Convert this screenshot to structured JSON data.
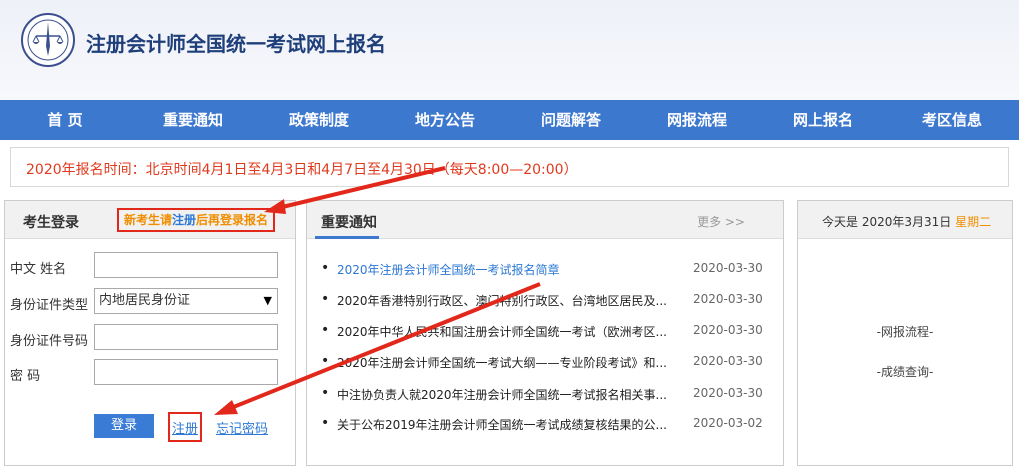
{
  "header": {
    "logo_icon": "seal-scales-icon",
    "site_title": "注册会计师全国统一考试网上报名"
  },
  "nav": {
    "items": [
      {
        "label": "首 页"
      },
      {
        "label": "重要通知"
      },
      {
        "label": "政策制度"
      },
      {
        "label": "地方公告"
      },
      {
        "label": "问题解答"
      },
      {
        "label": "网报流程"
      },
      {
        "label": "网上报名"
      },
      {
        "label": "考区信息"
      }
    ]
  },
  "notice": {
    "text": "2020年报名时间：北京时间4月1日至4月3日和4月7日至4月30日（每天8:00—20:00）"
  },
  "login": {
    "title": "考生登录",
    "hint_prefix": "新考生请",
    "hint_link": "注册",
    "hint_suffix": "后再登录报名",
    "name_label": "中文  姓名",
    "name_value": "",
    "idtype_label": "身份证件类型",
    "idtype_value": "内地居民身份证",
    "idnum_label": "身份证件号码",
    "idnum_value": "",
    "password_label": "密      码",
    "password_value": "",
    "login_button": "登录",
    "register_link": "注册",
    "forgot_link": "忘记密码"
  },
  "news": {
    "title": "重要通知",
    "more": "更多 >>",
    "items": [
      {
        "title": "2020年注册会计师全国统一考试报名简章",
        "date": "2020-03-30"
      },
      {
        "title": "2020年香港特别行政区、澳门特别行政区、台湾地区居民及...",
        "date": "2020-03-30"
      },
      {
        "title": "2020年中华人民共和国注册会计师全国统一考试（欧洲考区...",
        "date": "2020-03-30"
      },
      {
        "title": "2020年注册会计师全国统一考试大纲——专业阶段考试》和...",
        "date": "2020-03-30"
      },
      {
        "title": "中注协负责人就2020年注册会计师全国统一考试报名相关事...",
        "date": "2020-03-30"
      },
      {
        "title": "关于公布2019年注册会计师全国统一考试成绩复核结果的公...",
        "date": "2020-03-02"
      }
    ]
  },
  "sidebar": {
    "today_prefix": "今天是 2020年3月31日",
    "weekday": "星期二",
    "links": [
      {
        "label": "-网报流程-"
      },
      {
        "label": "-成绩查询-"
      }
    ]
  },
  "colors": {
    "nav_bg": "#3d78cf",
    "annotation_red": "#e2271b",
    "notice_red": "#e03a1e",
    "hint_orange": "#f08e00",
    "link_blue": "#2c78d4"
  }
}
